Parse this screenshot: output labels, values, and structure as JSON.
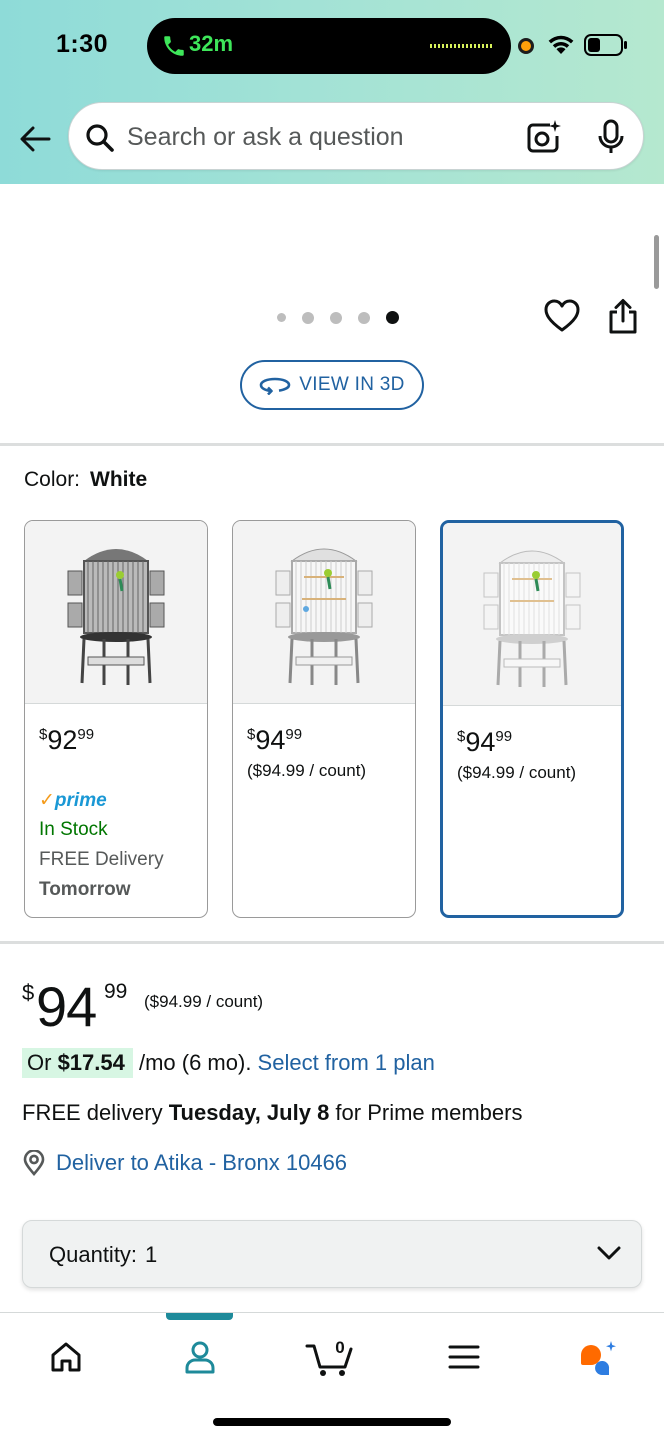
{
  "status_bar": {
    "time": "1:30",
    "call_duration": "32m"
  },
  "search": {
    "placeholder": "Search or ask a question"
  },
  "gallery": {
    "dot_count": 5,
    "active_dot": 5,
    "view_3d_label": "VIEW IN 3D"
  },
  "color": {
    "label": "Color:",
    "value": "White"
  },
  "swatches": [
    {
      "price_whole": "92",
      "price_cents": "99",
      "prime_label": "prime",
      "stock": "In Stock",
      "delivery": "FREE Delivery",
      "delivery_day": "Tomorrow",
      "selected": false
    },
    {
      "price_whole": "94",
      "price_cents": "99",
      "unit_price": "($94.99 / count)",
      "selected": false
    },
    {
      "price_whole": "94",
      "price_cents": "99",
      "unit_price": "($94.99 / count)",
      "selected": true
    }
  ],
  "price": {
    "currency": "$",
    "whole": "94",
    "cents": "99",
    "unit_price": "($94.99 / count)"
  },
  "finance": {
    "prefix": "Or ",
    "amount": "$17.54",
    "term": " /mo (6 mo). ",
    "link": "Select from 1 plan"
  },
  "delivery": {
    "prefix": "FREE delivery ",
    "date": "Tuesday, July 8",
    "suffix": " for Prime members"
  },
  "deliver_to": "Deliver to Atika - Bronx 10466",
  "quantity": {
    "label": "Quantity:",
    "value": "1"
  },
  "bottom_nav": {
    "cart_count": "0",
    "active_tab": "account"
  },
  "colors": {
    "link_blue": "#2162a1",
    "in_stock_green": "#007600",
    "prime_blue": "#1a98d5",
    "nav_active": "#1e8a9a",
    "header_gradient_start": "#8edbd8",
    "header_gradient_end": "#b5e8cf"
  }
}
